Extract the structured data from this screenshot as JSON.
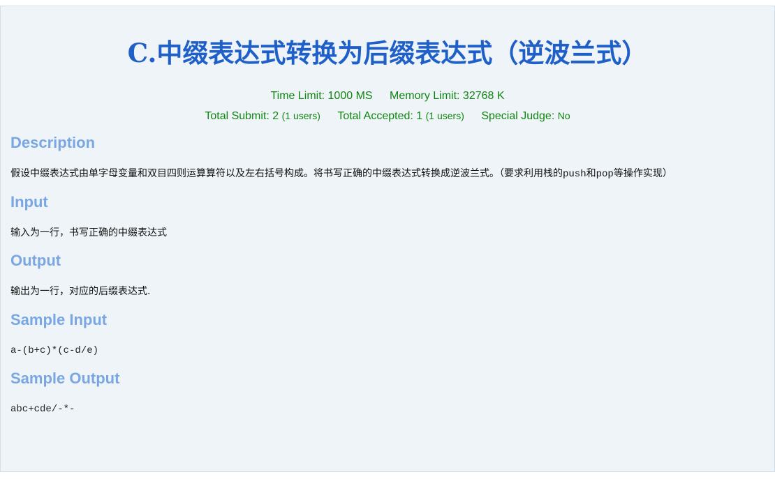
{
  "problem": {
    "title_prefix": "C.",
    "title_main": "中缀表达式转换为后缀表达式（逆波兰式）"
  },
  "meta": {
    "time_limit": "Time Limit: 1000 MS",
    "memory_limit": "Memory Limit: 32768 K",
    "total_submit": "Total Submit: 2",
    "submit_users": "(1 users)",
    "total_accepted": "Total Accepted: 1",
    "accepted_users": "(1 users)",
    "special_judge_label": "Special Judge:",
    "special_judge_value": "No"
  },
  "sections": {
    "description_heading": "Description",
    "description_text_1": "假设中缀表达式由单字母变量和双目四则运算算符以及左右括号构成。将书写正确的中缀表达式转换成逆波兰式。（要求利用栈的",
    "description_code_1": "push",
    "description_text_2": "和",
    "description_code_2": "pop",
    "description_text_3": "等操作实现）",
    "input_heading": "Input",
    "input_text": "输入为一行，书写正确的中缀表达式",
    "output_heading": "Output",
    "output_text": "输出为一行，对应的后缀表达式.",
    "sample_input_heading": "Sample Input",
    "sample_input": "a-(b+c)*(c-d/e)",
    "sample_output_heading": "Sample Output",
    "sample_output": "abc+cde/-*-"
  }
}
